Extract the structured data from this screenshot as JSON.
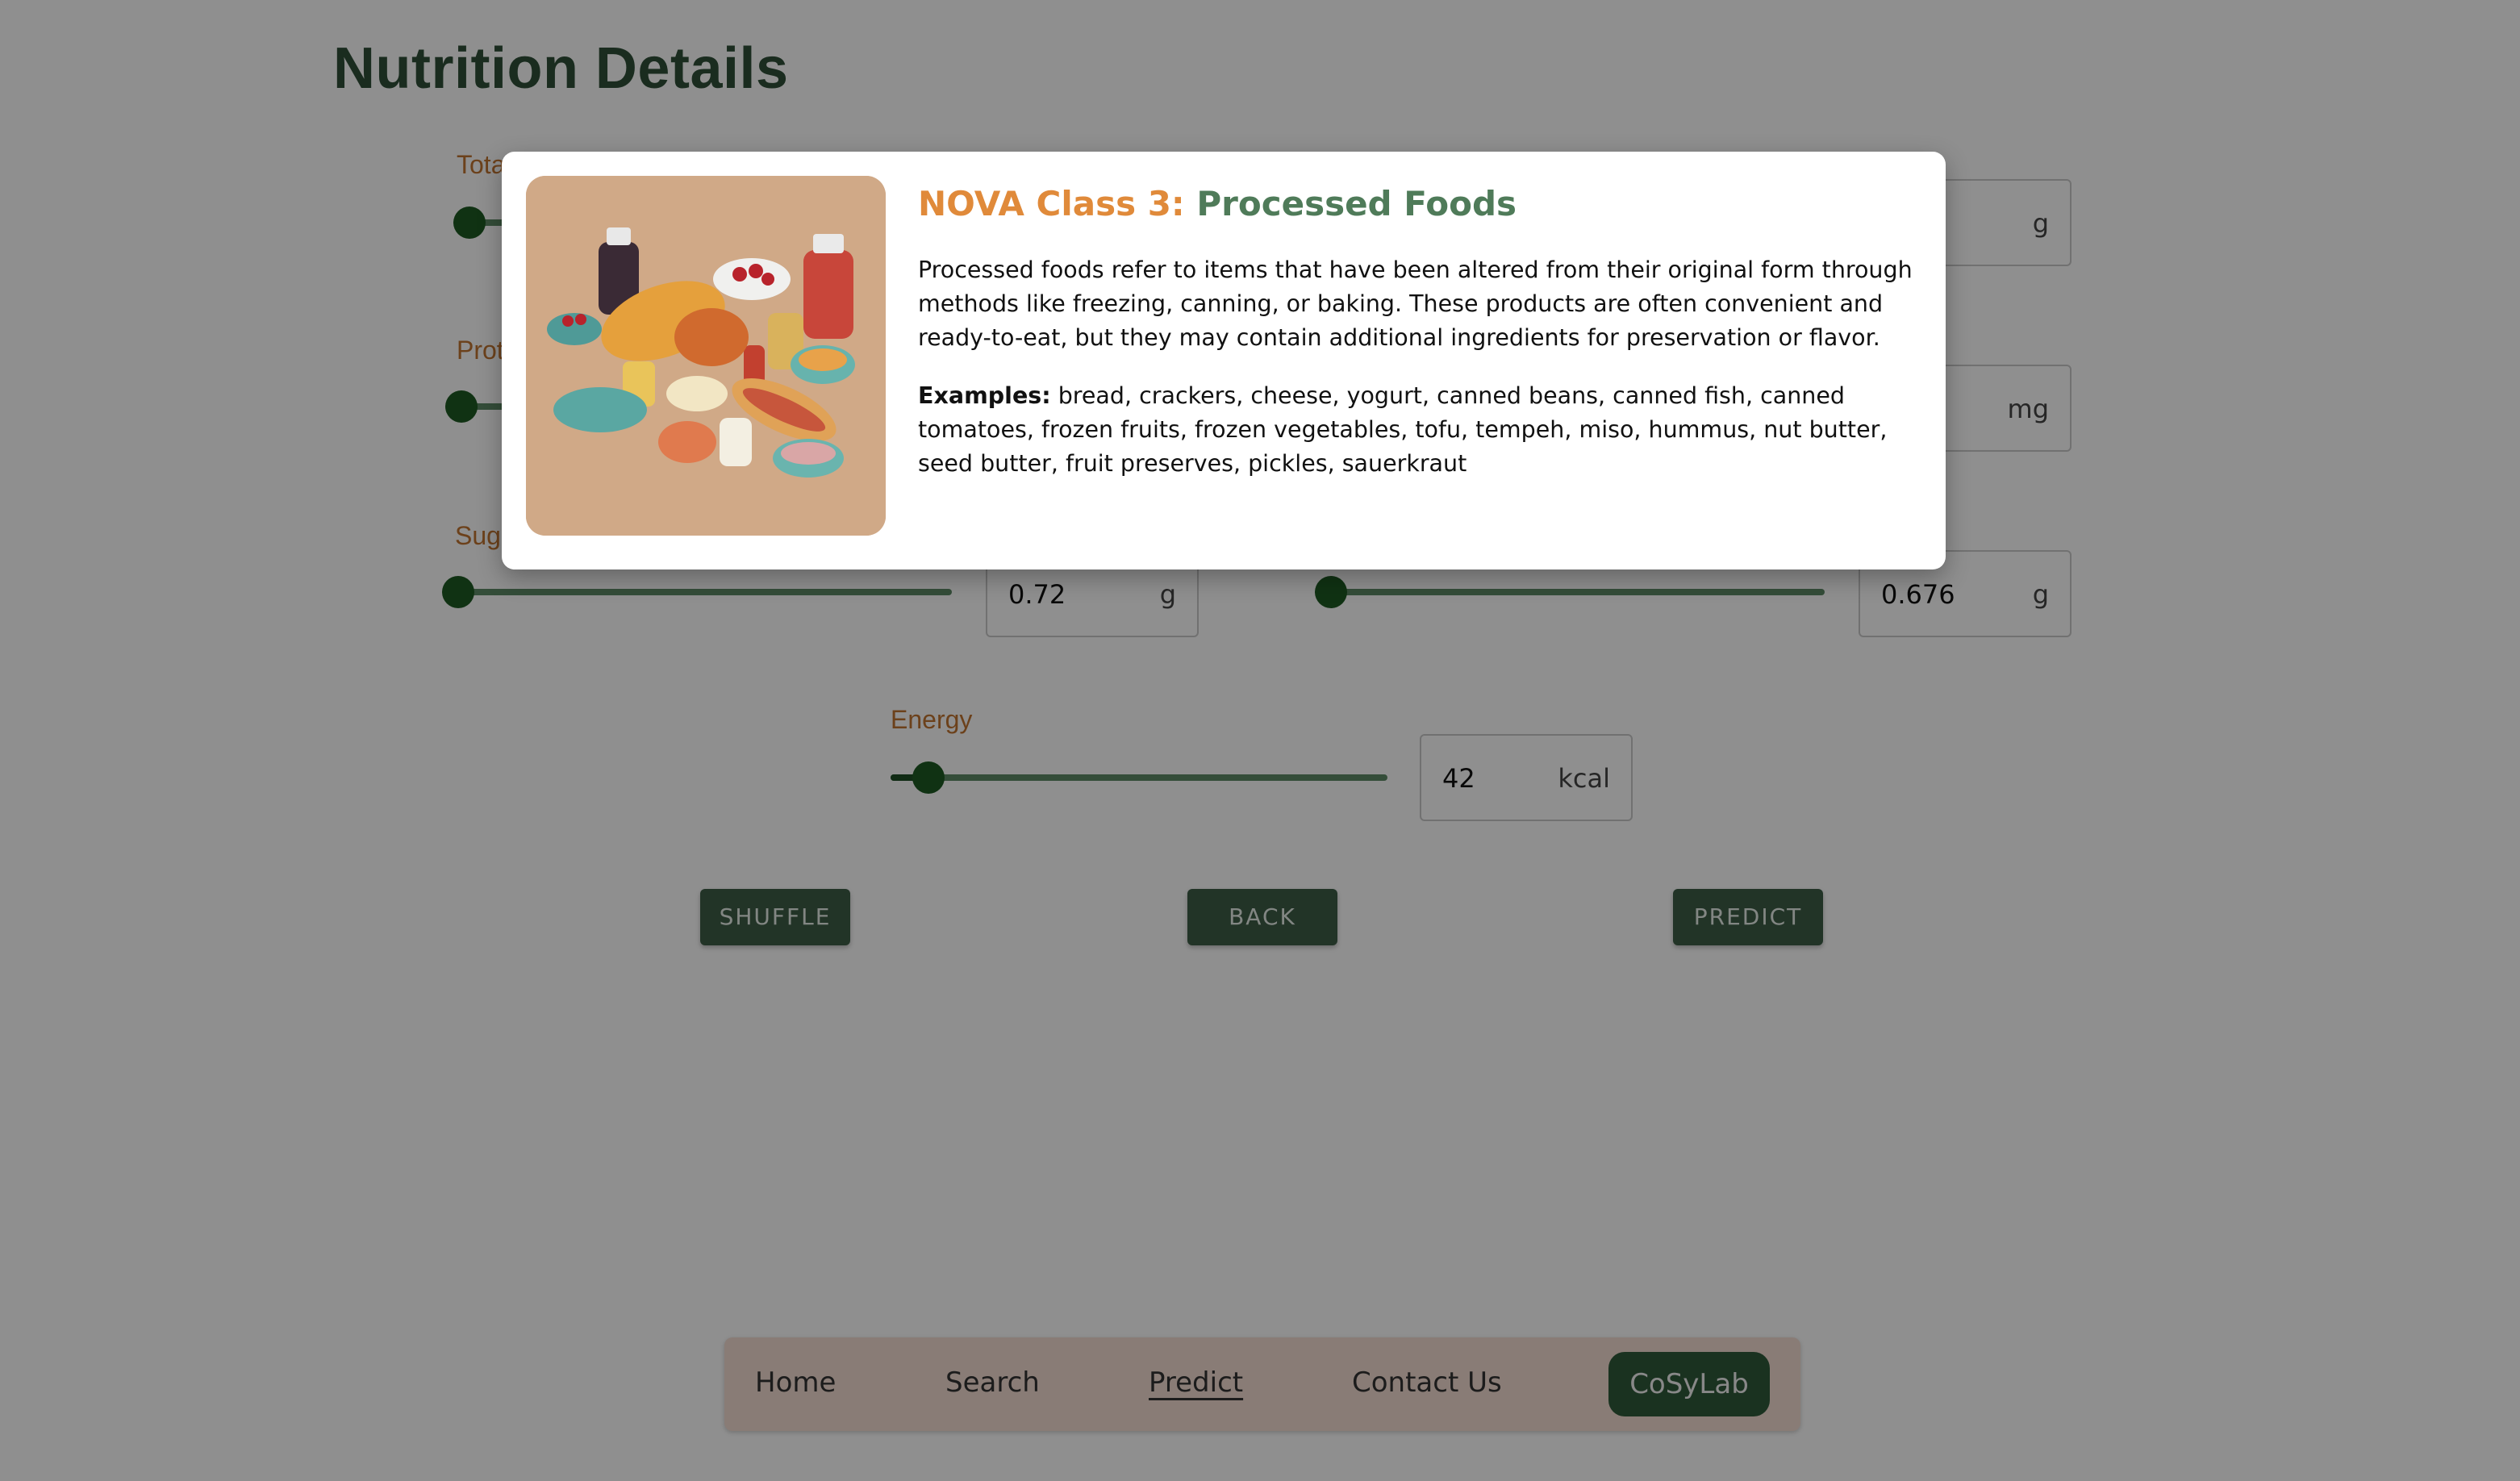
{
  "page": {
    "title": "Nutrition Details"
  },
  "fields": {
    "total": {
      "label": "Total"
    },
    "protein": {
      "label": "Protein"
    },
    "sugar": {
      "label": "Sugar",
      "value": "0.72",
      "unit": "g",
      "fraction": 0.0
    },
    "right_row1": {
      "unit": "g"
    },
    "right_row2": {
      "unit": "mg"
    },
    "right_row3": {
      "value": "0.676",
      "unit": "g",
      "fraction": 0.0
    },
    "energy": {
      "label": "Energy",
      "value": "42",
      "unit": "kcal",
      "fraction": 0.047
    }
  },
  "buttons": {
    "shuffle": "SHUFFLE",
    "back": "BACK",
    "predict": "PREDICT"
  },
  "nav": {
    "home": "Home",
    "search": "Search",
    "predict": "Predict",
    "contact": "Contact Us",
    "brand": "CoSyLab"
  },
  "modal": {
    "class_label": "NOVA Class 3:",
    "class_name": "Processed Foods",
    "description": "Processed foods refer to items that have been altered from their original form through methods like freezing, canning, or baking. These products are often convenient and ready-to-eat, but they may contain additional ingredients for preservation or flavor.",
    "examples_label": "Examples:",
    "examples_text": "bread, crackers, cheese, yogurt, canned beans, canned fish, canned tomatoes, frozen fruits, frozen vegetables, tofu, tempeh, miso, hummus, nut butter, seed butter, fruit preserves, pickles, sauerkraut"
  },
  "colors": {
    "accent_green": "#2f4f38",
    "label_orange": "#c07430",
    "class_orange": "#e08a3a",
    "class_green": "#4f7b59"
  }
}
